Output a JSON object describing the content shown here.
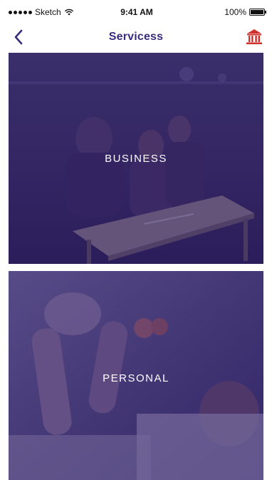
{
  "status_bar": {
    "carrier": "Sketch",
    "time": "9:41 AM",
    "battery": "100%",
    "battery_level": 1.0
  },
  "nav": {
    "title": "Servicess",
    "back_icon": "chevron-left-icon",
    "right_icon": "bank-icon",
    "accent_color": "#3a2d7a",
    "icon_color": "#d0312d"
  },
  "services": [
    {
      "label": "BUSINESS"
    },
    {
      "label": "PERSONAL"
    }
  ],
  "colors": {
    "overlay": "#2d1c6e"
  }
}
